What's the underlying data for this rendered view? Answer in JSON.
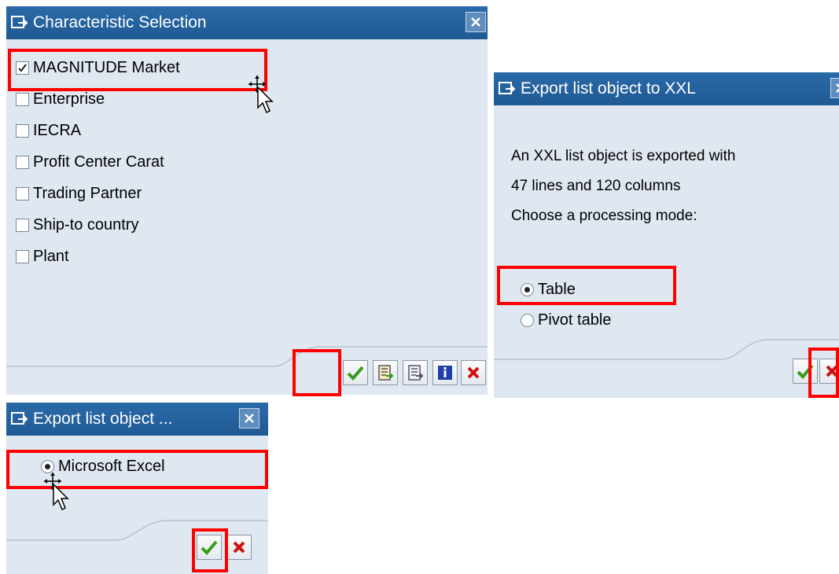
{
  "dialog_characteristics": {
    "title": "Characteristic Selection",
    "items": [
      {
        "label": "MAGNITUDE Market",
        "checked": true
      },
      {
        "label": "Enterprise",
        "checked": false
      },
      {
        "label": "IECRA",
        "checked": false
      },
      {
        "label": "Profit Center Carat",
        "checked": false
      },
      {
        "label": "Trading Partner",
        "checked": false
      },
      {
        "label": "Ship-to country",
        "checked": false
      },
      {
        "label": "Plant",
        "checked": false
      }
    ],
    "buttons": [
      "check-icon",
      "select-all-icon",
      "deselect-all-icon",
      "info-icon",
      "cancel-icon"
    ]
  },
  "dialog_xxl": {
    "title": "Export list object to XXL",
    "line1": "An XXL list object is exported with",
    "line2": "47 lines and 120 columns",
    "line3": "Choose a processing mode:",
    "options": [
      {
        "label": "Table",
        "selected": true
      },
      {
        "label": "Pivot table",
        "selected": false
      }
    ]
  },
  "dialog_format": {
    "title": "Export list object ...",
    "options": [
      {
        "label": "Microsoft Excel",
        "selected": true
      }
    ]
  },
  "colors": {
    "title_bar": "#1f5a94",
    "dialog_bg": "#dfe7f0",
    "highlight": "#ff0000",
    "check_green": "#3a9a1a",
    "cancel_red": "#d01010"
  }
}
